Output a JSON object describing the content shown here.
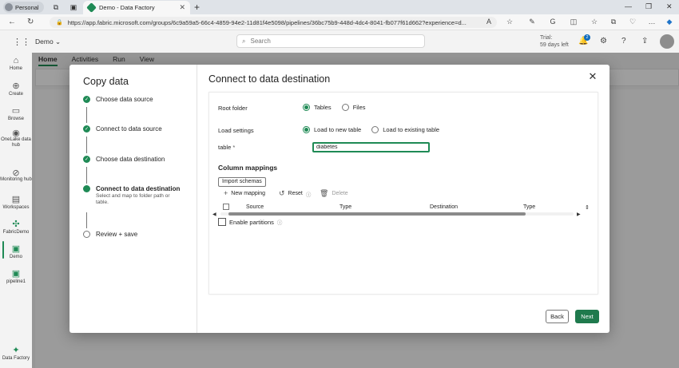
{
  "browser": {
    "profile_label": "Personal",
    "tab_title": "Demo - Data Factory",
    "tab_close": "✕",
    "new_tab": "+",
    "url": "https://app.fabric.microsoft.com/groups/6c9a59a5-66c4-4859-94e2-11d81f4e5098/pipelines/36bc75b9-448d-4dc4-8041-fb077f61d662?experience=d..."
  },
  "app_header": {
    "workspace_label": "Demo",
    "search_placeholder": "Search",
    "trial_line1": "Trial:",
    "trial_line2": "59 days left",
    "notification_count": "2"
  },
  "rail": {
    "items": [
      {
        "label": "Home"
      },
      {
        "label": "Create"
      },
      {
        "label": "Browse"
      },
      {
        "label": "OneLake data hub"
      },
      {
        "label": "Monitoring hub"
      },
      {
        "label": "Workspaces"
      },
      {
        "label": "FabricDemo"
      },
      {
        "label": "Demo"
      },
      {
        "label": "pipeline1"
      },
      {
        "label": "Data Factory"
      }
    ]
  },
  "ribbon": {
    "tabs": [
      "Home",
      "Activities",
      "Run",
      "View"
    ]
  },
  "dialog": {
    "steps_title": "Copy data",
    "steps": [
      {
        "label": "Choose data source",
        "state": "done"
      },
      {
        "label": "Connect to data source",
        "state": "done"
      },
      {
        "label": "Choose data destination",
        "state": "done"
      },
      {
        "label": "Connect to data destination",
        "state": "current",
        "description": "Select and map to folder path or table."
      },
      {
        "label": "Review + save",
        "state": "pending"
      }
    ],
    "title": "Connect to data destination",
    "root_folder_label": "Root folder",
    "root_folder_options": [
      "Tables",
      "Files"
    ],
    "root_folder_selected": "Tables",
    "load_settings_label": "Load settings",
    "load_options": [
      "Load to new table",
      "Load to existing table"
    ],
    "load_selected": "Load to new table",
    "table_label": "table",
    "table_required_mark": "*",
    "table_value": "diabetes",
    "column_mappings_label": "Column mappings",
    "import_schemas_label": "Import schemas",
    "new_mapping_label": "New mapping",
    "reset_label": "Reset",
    "delete_label": "Delete",
    "grid_columns": [
      "Source",
      "Type",
      "Destination",
      "Type"
    ],
    "enable_partitions_label": "Enable partitions",
    "back_label": "Back",
    "next_label": "Next"
  },
  "colors": {
    "accent": "#1f7a4d",
    "step_done": "#1f8a55"
  }
}
